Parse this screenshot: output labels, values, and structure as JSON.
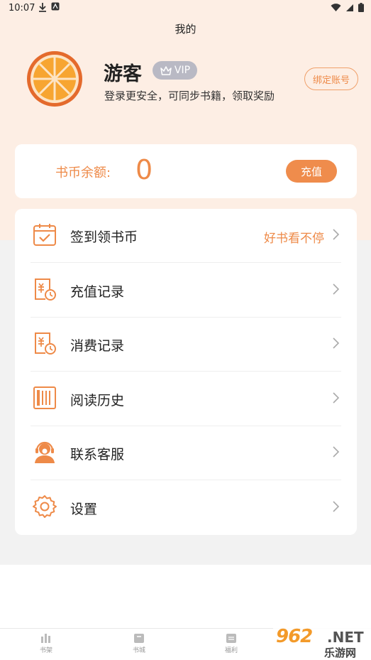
{
  "status_bar": {
    "time": "10:07"
  },
  "header": {
    "title": "我的"
  },
  "profile": {
    "name": "游客",
    "vip_label": "VIP",
    "subtitle": "登录更安全，可同步书籍，领取奖励",
    "bind_button": "绑定账号"
  },
  "coins": {
    "label": "书币余额:",
    "value": "0",
    "recharge_button": "充值"
  },
  "menu": {
    "items": [
      {
        "label": "签到领书币",
        "extra": "好书看不停",
        "icon": "calendar-check-icon"
      },
      {
        "label": "充值记录",
        "extra": "",
        "icon": "recharge-record-icon"
      },
      {
        "label": "消费记录",
        "extra": "",
        "icon": "consume-record-icon"
      },
      {
        "label": "阅读历史",
        "extra": "",
        "icon": "bookshelf-history-icon"
      },
      {
        "label": "联系客服",
        "extra": "",
        "icon": "customer-service-icon"
      },
      {
        "label": "设置",
        "extra": "",
        "icon": "gear-icon"
      }
    ]
  },
  "bottom_nav": {
    "items": [
      {
        "label": "书架",
        "icon": "bookshelf-icon"
      },
      {
        "label": "书城",
        "icon": "bookstore-icon"
      },
      {
        "label": "福利",
        "icon": "welfare-icon"
      }
    ]
  },
  "watermark": {
    "number": "962",
    "suffix": ".NET",
    "sub": "乐游网"
  },
  "colors": {
    "accent": "#ee8a48",
    "peach_bg": "#fdeee4",
    "gray_bg": "#f2f2f2"
  }
}
